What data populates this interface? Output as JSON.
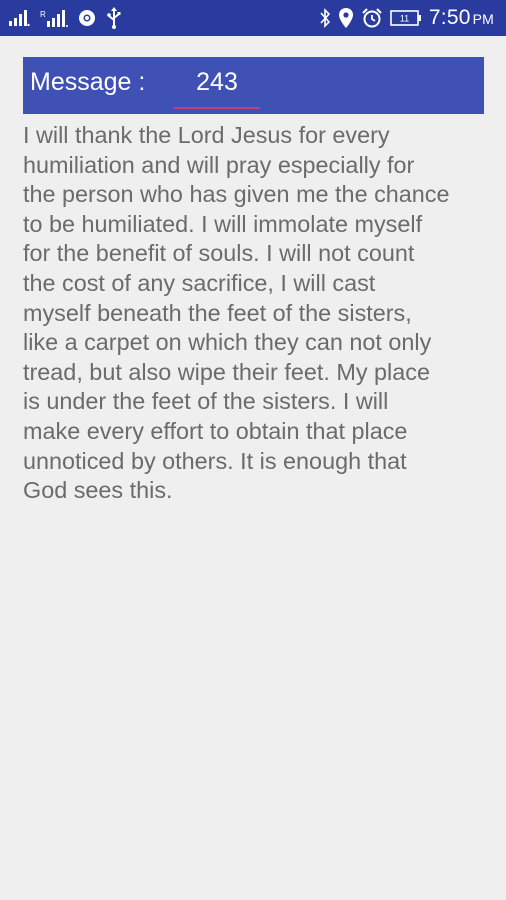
{
  "status_bar": {
    "time": "7:50",
    "ampm": "PM",
    "battery_level": "11",
    "left_icons": [
      "signal-1-icon",
      "signal-2-icon",
      "chrome-icon",
      "usb-icon"
    ],
    "right_icons": [
      "bluetooth-icon",
      "location-icon",
      "alarm-icon",
      "battery-icon"
    ]
  },
  "header": {
    "label": "Message :",
    "number": "243",
    "background": "#3f51b5",
    "underline_color": "#c2407a"
  },
  "message": {
    "text": "I will thank the Lord Jesus for every\nhumiliation and will pray especially for\nthe person who has given me the chance\nto be humiliated. I will immolate myself\nfor the benefit of souls. I will not count\nthe cost of any sacrifice, I will cast\nmyself beneath the feet of the sisters,\nlike a carpet on which they can not only\ntread, but also wipe their feet. My place\n is under the feet of the sisters. I will\nmake every effort to obtain that place\nunnoticed by others. It is enough that\nGod sees this."
  }
}
